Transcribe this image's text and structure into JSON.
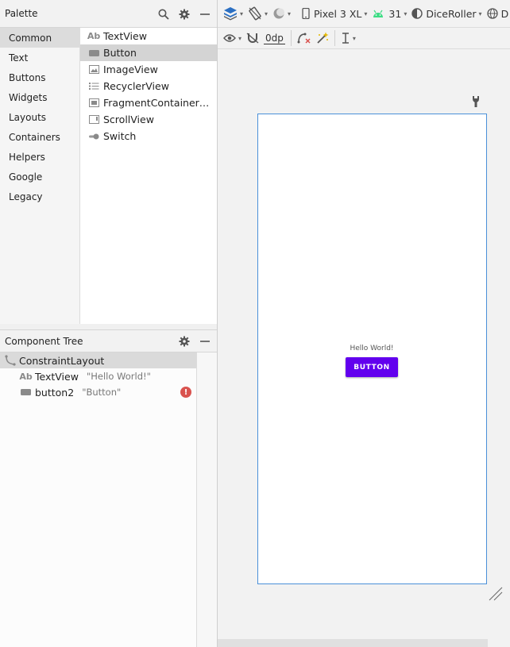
{
  "palette": {
    "title": "Palette",
    "categories": [
      "Common",
      "Text",
      "Buttons",
      "Widgets",
      "Layouts",
      "Containers",
      "Helpers",
      "Google",
      "Legacy"
    ],
    "selected_category": "Common",
    "widgets": [
      {
        "label": "TextView",
        "icon": "text-ab-icon"
      },
      {
        "label": "Button",
        "icon": "button-icon"
      },
      {
        "label": "ImageView",
        "icon": "image-icon"
      },
      {
        "label": "RecyclerView",
        "icon": "list-icon"
      },
      {
        "label": "FragmentContainer…",
        "icon": "fragment-icon"
      },
      {
        "label": "ScrollView",
        "icon": "scroll-icon"
      },
      {
        "label": "Switch",
        "icon": "switch-icon"
      }
    ],
    "selected_widget": "Button"
  },
  "component_tree": {
    "title": "Component Tree",
    "root": {
      "label": "ConstraintLayout",
      "icon": "constraint-layout-icon"
    },
    "children": [
      {
        "label": "TextView",
        "sub": "\"Hello World!\"",
        "icon": "text-ab-icon",
        "error": false
      },
      {
        "label": "button2",
        "sub": "\"Button\"",
        "icon": "button-icon",
        "error": true
      }
    ]
  },
  "toolbar": {
    "device": "Pixel 3 XL",
    "api": "31",
    "theme": "DiceRoller",
    "locale_partial": "D",
    "margin": "0dp"
  },
  "preview": {
    "text": "Hello World!",
    "button": "BUTTON"
  },
  "colors": {
    "accent_blue": "#4a90d9",
    "button_purple": "#6200ee",
    "android_green": "#3ddc84",
    "error_red": "#d9534f"
  }
}
